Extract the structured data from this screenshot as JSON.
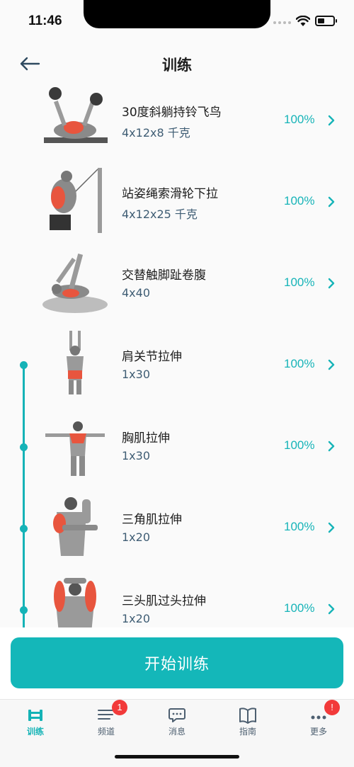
{
  "status_bar": {
    "time": "11:46"
  },
  "header": {
    "title": "训练"
  },
  "exercises": [
    {
      "name": "30度斜躺持铃飞鸟",
      "detail": "4x12x8 千克",
      "percent": "100%"
    },
    {
      "name": "站姿绳索滑轮下拉",
      "detail": "4x12x25 千克",
      "percent": "100%"
    },
    {
      "name": "交替触脚趾卷腹",
      "detail": "4x40",
      "percent": "100%"
    },
    {
      "name": "肩关节拉伸",
      "detail": "1x30",
      "percent": "100%"
    },
    {
      "name": "胸肌拉伸",
      "detail": "1x30",
      "percent": "100%"
    },
    {
      "name": "三角肌拉伸",
      "detail": "1x20",
      "percent": "100%"
    },
    {
      "name": "三头肌过头拉伸",
      "detail": "1x20",
      "percent": "100%"
    }
  ],
  "start_button": {
    "label": "开始训练"
  },
  "tabs": [
    {
      "label": "训练",
      "icon": "dumbbell-icon",
      "active": true
    },
    {
      "label": "频道",
      "icon": "list-icon",
      "badge": "1"
    },
    {
      "label": "消息",
      "icon": "chat-bubble-icon"
    },
    {
      "label": "指南",
      "icon": "book-icon"
    },
    {
      "label": "更多",
      "icon": "more-dots-icon",
      "badge": "!"
    }
  ],
  "colors": {
    "accent": "#14b7b9",
    "badge": "#f23a3a",
    "muscle": "#e8553e"
  }
}
